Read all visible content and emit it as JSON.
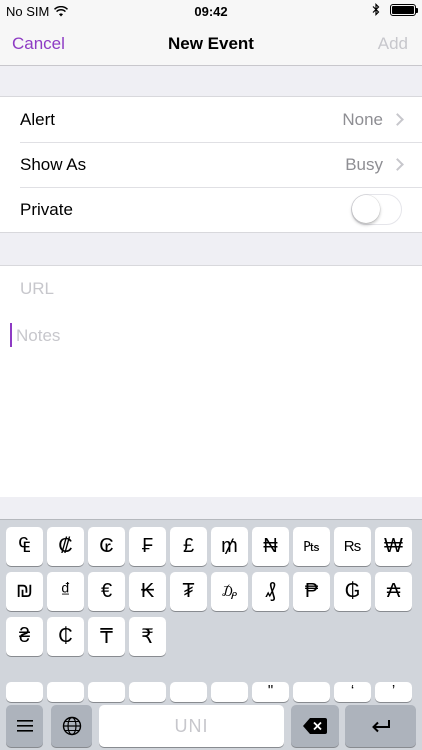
{
  "status_bar": {
    "carrier": "No SIM",
    "time": "09:42"
  },
  "nav": {
    "cancel": "Cancel",
    "title": "New Event",
    "add": "Add"
  },
  "settings": {
    "alert": {
      "label": "Alert",
      "value": "None"
    },
    "show_as": {
      "label": "Show As",
      "value": "Busy"
    },
    "private": {
      "label": "Private",
      "on": false
    }
  },
  "fields": {
    "url_placeholder": "URL",
    "notes_placeholder": "Notes"
  },
  "keyboard": {
    "row1": [
      "₠",
      "₡",
      "₢",
      "₣",
      "£",
      "₥",
      "₦",
      "₧",
      "₨",
      "₩"
    ],
    "row2": [
      "₪",
      "₫",
      "€",
      "₭",
      "₮",
      "₯",
      "₰",
      "₱",
      "₲",
      "₳"
    ],
    "row3": [
      "₴",
      "₵",
      "₸",
      "₹"
    ],
    "row4_partial": [
      "",
      "",
      "",
      "",
      "",
      "",
      "\"",
      "",
      "‘",
      "’"
    ],
    "space_label": "UNI"
  },
  "colors": {
    "accent": "#8e3bc4",
    "disabled": "#c7c7cc"
  }
}
